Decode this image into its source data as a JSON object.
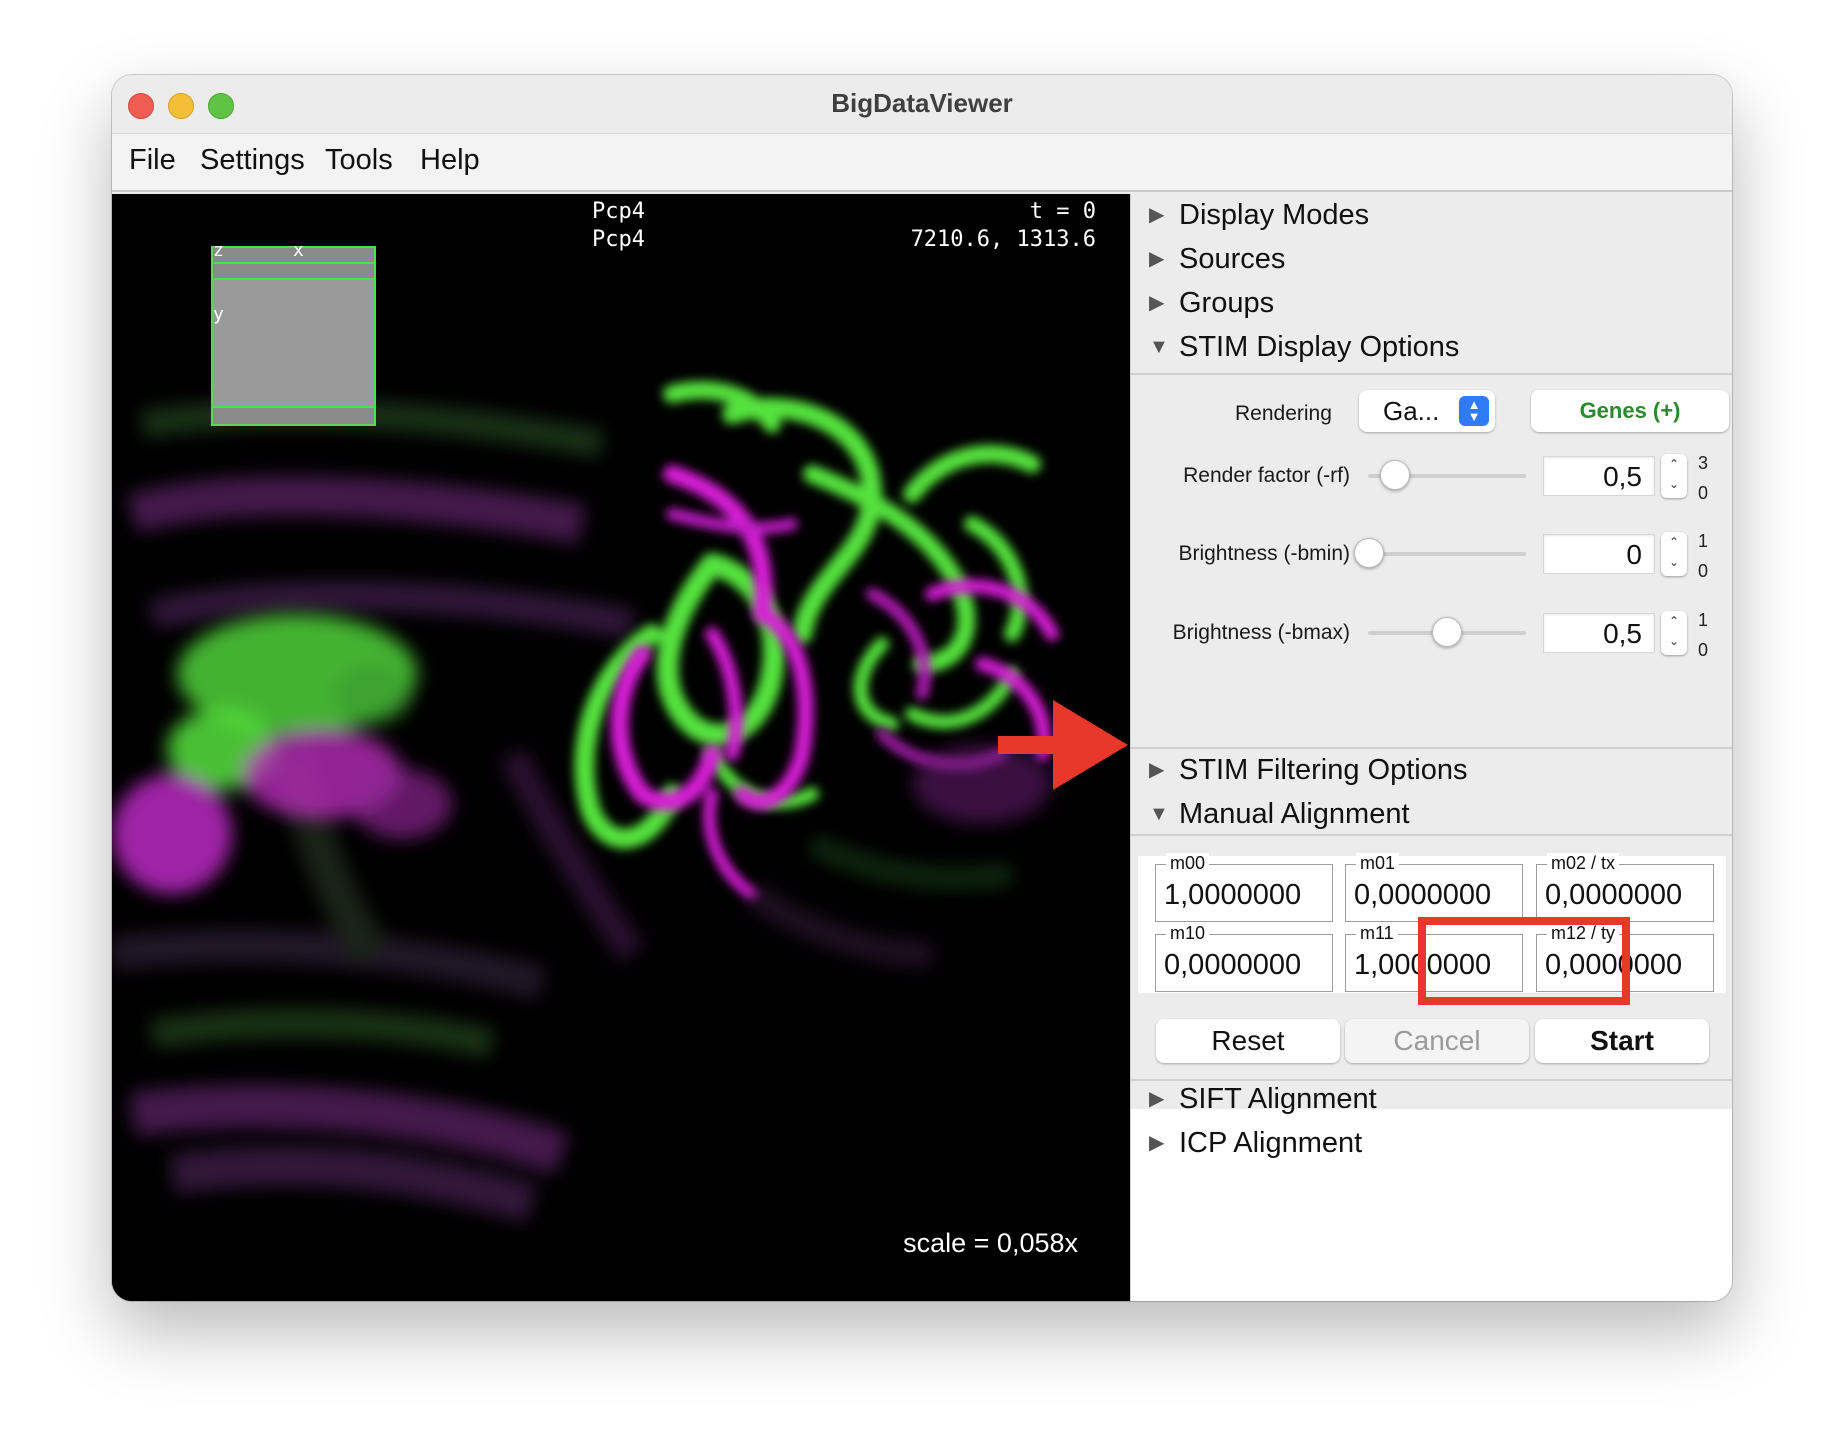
{
  "window": {
    "title": "BigDataViewer"
  },
  "menu": [
    "File",
    "Settings",
    "Tools",
    "Help"
  ],
  "viewer": {
    "source_line1": "Pcp4",
    "source_line2": "Pcp4",
    "timepoint": "t = 0",
    "coordinates": "7210.6, 1313.6",
    "scale": "scale = 0,058x",
    "nav_labels": {
      "z": "z",
      "x": "x",
      "y": "y"
    }
  },
  "panel": {
    "sections": {
      "display_modes": "Display Modes",
      "sources": "Sources",
      "groups": "Groups",
      "stim_display": "STIM Display Options",
      "stim_filtering": "STIM Filtering Options",
      "manual_alignment": "Manual Alignment",
      "sift_alignment": "SIFT Alignment",
      "icp_alignment": "ICP Alignment"
    },
    "stim_display": {
      "rendering_label": "Rendering",
      "rendering_value": "Ga...",
      "genes_button": "Genes (+)",
      "render_factor": {
        "label": "Render factor (-rf)",
        "value": "0,5",
        "max": "3",
        "min": "0",
        "level": 0.17
      },
      "brightness_min": {
        "label": "Brightness (-bmin)",
        "value": "0",
        "max": "1",
        "min": "0",
        "level": 0.0
      },
      "brightness_max": {
        "label": "Brightness (-bmax)",
        "value": "0,5",
        "max": "1",
        "min": "0",
        "level": 0.5
      }
    },
    "manual_alignment": {
      "fields": [
        {
          "caption": "m00",
          "value": "1,0000000"
        },
        {
          "caption": "m01",
          "value": "0,0000000"
        },
        {
          "caption": "m02 / tx",
          "value": "0,0000000"
        },
        {
          "caption": "m10",
          "value": "0,0000000"
        },
        {
          "caption": "m11",
          "value": "1,0000000"
        },
        {
          "caption": "m12 / ty",
          "value": "0,0000000"
        }
      ],
      "reset_label": "Reset",
      "cancel_label": "Cancel",
      "start_label": "Start"
    }
  },
  "colors": {
    "highlight": "#e8372b",
    "green_channel": "#55e23c",
    "magenta_channel": "#d81fd8",
    "genes_text": "#2b8a2b"
  }
}
